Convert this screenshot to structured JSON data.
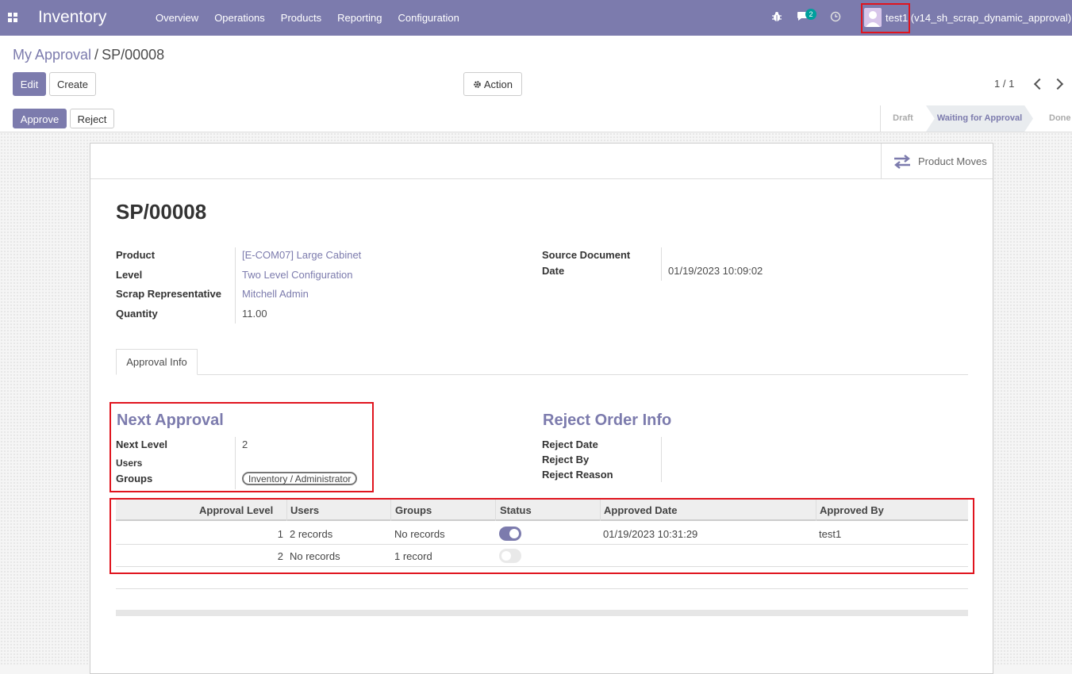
{
  "topbar": {
    "app_title": "Inventory",
    "menu": [
      "Overview",
      "Operations",
      "Products",
      "Reporting",
      "Configuration"
    ],
    "chat_count": "2",
    "user_label": "test1 (v14_sh_scrap_dynamic_approval)"
  },
  "breadcrumb": {
    "parent": "My Approval",
    "separator": "/",
    "current": "SP/00008"
  },
  "buttons": {
    "edit": "Edit",
    "create": "Create",
    "action": "Action",
    "approve": "Approve",
    "reject": "Reject"
  },
  "pager": "1 / 1",
  "stages": [
    "Draft",
    "Waiting for Approval",
    "Done"
  ],
  "active_stage": "Waiting for Approval",
  "smart_button": "Product Moves",
  "record": {
    "title": "SP/00008",
    "fields_left": [
      {
        "label": "Product",
        "value": "[E-COM07] Large Cabinet",
        "link": true
      },
      {
        "label": "Level",
        "value": "Two Level Configuration",
        "link": true
      },
      {
        "label": "Scrap Representative",
        "value": "Mitchell Admin",
        "link": true
      },
      {
        "label": "Quantity",
        "value": "11.00",
        "link": false
      }
    ],
    "fields_right": [
      {
        "label": "Source Document",
        "value": ""
      },
      {
        "label": "Date",
        "value": "01/19/2023 10:09:02"
      }
    ]
  },
  "tab": "Approval Info",
  "next_approval": {
    "title": "Next Approval",
    "next_level_label": "Next Level",
    "next_level_value": "2",
    "users_label": "Users",
    "groups_label": "Groups",
    "groups_tag": "Inventory / Administrator"
  },
  "reject_info": {
    "title": "Reject Order Info",
    "reject_date_label": "Reject Date",
    "reject_by_label": "Reject By",
    "reject_reason_label": "Reject Reason"
  },
  "approval_table": {
    "headers": [
      "Approval Level",
      "Users",
      "Groups",
      "Status",
      "Approved Date",
      "Approved By"
    ],
    "rows": [
      {
        "level": "1",
        "users": "2 records",
        "groups": "No records",
        "status": true,
        "approved_date": "01/19/2023 10:31:29",
        "approved_by": "test1"
      },
      {
        "level": "2",
        "users": "No records",
        "groups": "1 record",
        "status": false,
        "approved_date": "",
        "approved_by": ""
      }
    ]
  },
  "colors": {
    "brand": "#7c7bad",
    "highlight": "#e0141e",
    "chat_badge": "#00a09d"
  }
}
